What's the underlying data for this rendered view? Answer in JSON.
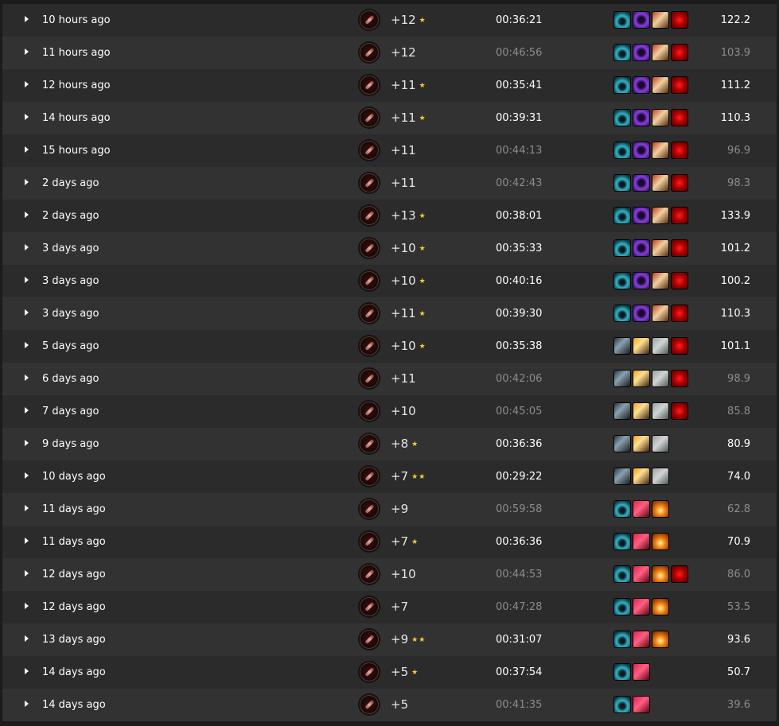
{
  "runs": [
    {
      "ago": "10 hours ago",
      "level": "+12",
      "stars": "★",
      "time": "00:36:21",
      "timed": true,
      "affixes": [
        "fortified",
        "tyrannical",
        "inspiring",
        "sanguine"
      ],
      "score": "122.2"
    },
    {
      "ago": "11 hours ago",
      "level": "+12",
      "stars": "",
      "time": "00:46:56",
      "timed": false,
      "affixes": [
        "fortified",
        "tyrannical",
        "inspiring",
        "sanguine"
      ],
      "score": "103.9"
    },
    {
      "ago": "12 hours ago",
      "level": "+11",
      "stars": "★",
      "time": "00:35:41",
      "timed": true,
      "affixes": [
        "fortified",
        "tyrannical",
        "inspiring",
        "sanguine"
      ],
      "score": "111.2"
    },
    {
      "ago": "14 hours ago",
      "level": "+11",
      "stars": "★",
      "time": "00:39:31",
      "timed": true,
      "affixes": [
        "fortified",
        "tyrannical",
        "inspiring",
        "sanguine"
      ],
      "score": "110.3"
    },
    {
      "ago": "15 hours ago",
      "level": "+11",
      "stars": "",
      "time": "00:44:13",
      "timed": false,
      "affixes": [
        "fortified",
        "tyrannical",
        "inspiring",
        "sanguine"
      ],
      "score": "96.9"
    },
    {
      "ago": "2 days ago",
      "level": "+11",
      "stars": "",
      "time": "00:42:43",
      "timed": false,
      "affixes": [
        "fortified",
        "tyrannical",
        "inspiring",
        "sanguine"
      ],
      "score": "98.3"
    },
    {
      "ago": "2 days ago",
      "level": "+13",
      "stars": "★",
      "time": "00:38:01",
      "timed": true,
      "affixes": [
        "fortified",
        "tyrannical",
        "inspiring",
        "sanguine"
      ],
      "score": "133.9"
    },
    {
      "ago": "3 days ago",
      "level": "+10",
      "stars": "★",
      "time": "00:35:33",
      "timed": true,
      "affixes": [
        "fortified",
        "tyrannical",
        "inspiring",
        "sanguine"
      ],
      "score": "101.2"
    },
    {
      "ago": "3 days ago",
      "level": "+10",
      "stars": "★",
      "time": "00:40:16",
      "timed": true,
      "affixes": [
        "fortified",
        "tyrannical",
        "inspiring",
        "sanguine"
      ],
      "score": "100.2"
    },
    {
      "ago": "3 days ago",
      "level": "+11",
      "stars": "★",
      "time": "00:39:30",
      "timed": true,
      "affixes": [
        "fortified",
        "tyrannical",
        "inspiring",
        "sanguine"
      ],
      "score": "110.3"
    },
    {
      "ago": "5 days ago",
      "level": "+10",
      "stars": "★",
      "time": "00:35:38",
      "timed": true,
      "affixes": [
        "shadow",
        "flame",
        "stone",
        "sanguine"
      ],
      "score": "101.1"
    },
    {
      "ago": "6 days ago",
      "level": "+11",
      "stars": "",
      "time": "00:42:06",
      "timed": false,
      "affixes": [
        "shadow",
        "flame",
        "stone",
        "sanguine"
      ],
      "score": "98.9"
    },
    {
      "ago": "7 days ago",
      "level": "+10",
      "stars": "",
      "time": "00:45:05",
      "timed": false,
      "affixes": [
        "shadow",
        "flame",
        "stone",
        "sanguine"
      ],
      "score": "85.8"
    },
    {
      "ago": "9 days ago",
      "level": "+8",
      "stars": "★",
      "time": "00:36:36",
      "timed": true,
      "affixes": [
        "shadow",
        "flame",
        "stone"
      ],
      "score": "80.9"
    },
    {
      "ago": "10 days ago",
      "level": "+7",
      "stars": "★★",
      "time": "00:29:22",
      "timed": true,
      "affixes": [
        "shadow",
        "flame",
        "stone"
      ],
      "score": "74.0"
    },
    {
      "ago": "11 days ago",
      "level": "+9",
      "stars": "",
      "time": "00:59:58",
      "timed": false,
      "affixes": [
        "fortified",
        "bolster",
        "volcanic"
      ],
      "score": "62.8"
    },
    {
      "ago": "11 days ago",
      "level": "+7",
      "stars": "★",
      "time": "00:36:36",
      "timed": true,
      "affixes": [
        "fortified",
        "bolster",
        "volcanic"
      ],
      "score": "70.9"
    },
    {
      "ago": "12 days ago",
      "level": "+10",
      "stars": "",
      "time": "00:44:53",
      "timed": false,
      "affixes": [
        "fortified",
        "bolster",
        "volcanic",
        "sanguine"
      ],
      "score": "86.0"
    },
    {
      "ago": "12 days ago",
      "level": "+7",
      "stars": "",
      "time": "00:47:28",
      "timed": false,
      "affixes": [
        "fortified",
        "bolster",
        "volcanic"
      ],
      "score": "53.5"
    },
    {
      "ago": "13 days ago",
      "level": "+9",
      "stars": "★★",
      "time": "00:31:07",
      "timed": true,
      "affixes": [
        "fortified",
        "bolster",
        "volcanic"
      ],
      "score": "93.6"
    },
    {
      "ago": "14 days ago",
      "level": "+5",
      "stars": "★",
      "time": "00:37:54",
      "timed": true,
      "affixes": [
        "fortified",
        "bolster"
      ],
      "score": "50.7"
    },
    {
      "ago": "14 days ago",
      "level": "+5",
      "stars": "",
      "time": "00:41:35",
      "timed": false,
      "affixes": [
        "fortified",
        "bolster"
      ],
      "score": "39.6"
    }
  ]
}
